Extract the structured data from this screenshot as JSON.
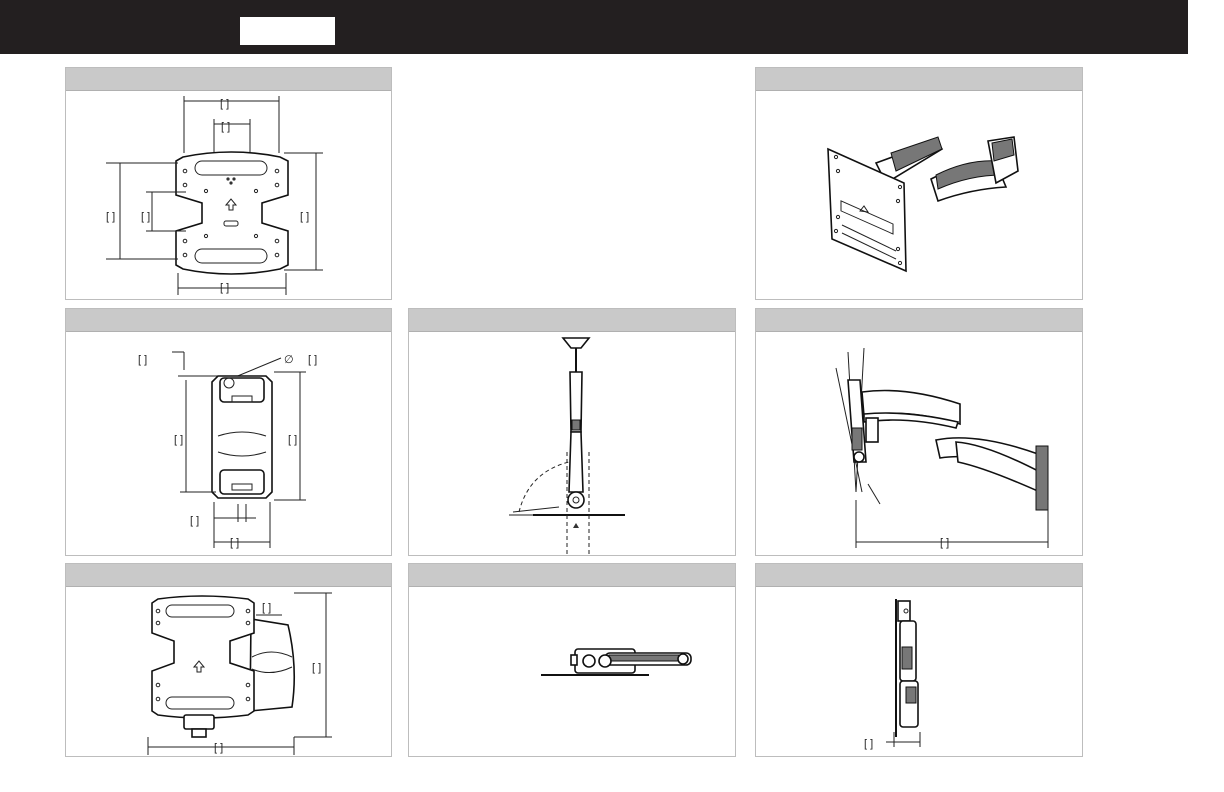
{
  "header": {
    "model_label": ""
  },
  "panels": [
    {
      "id": "plate-front",
      "title": ""
    },
    {
      "id": "isometric",
      "title": ""
    },
    {
      "id": "wall-plate",
      "title": ""
    },
    {
      "id": "top-swivel",
      "title": ""
    },
    {
      "id": "side-tilt",
      "title": ""
    },
    {
      "id": "front-extended",
      "title": ""
    },
    {
      "id": "top-folded",
      "title": ""
    },
    {
      "id": "side-folded",
      "title": ""
    }
  ],
  "dimension_marks": {
    "bracket": "[    ]",
    "diameter_symbol": "∅"
  }
}
